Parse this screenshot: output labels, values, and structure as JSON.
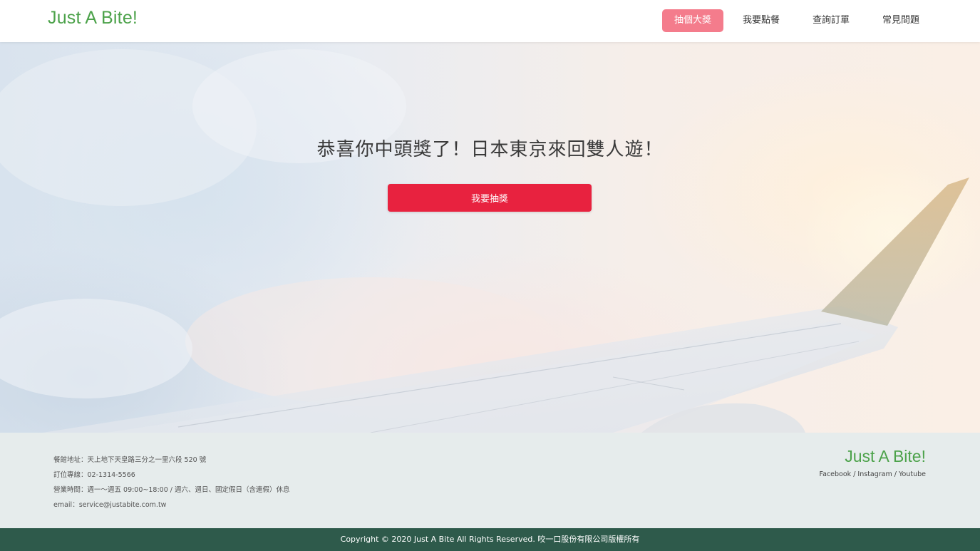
{
  "header": {
    "logo": "Just A Bite!",
    "nav": [
      {
        "label": "抽個大獎",
        "active": true
      },
      {
        "label": "我要點餐",
        "active": false
      },
      {
        "label": "查詢訂單",
        "active": false
      },
      {
        "label": "常見問題",
        "active": false
      }
    ]
  },
  "hero": {
    "title": "恭喜你中頭獎了！日本東京來回雙人遊！",
    "button_label": "我要抽獎"
  },
  "footer": {
    "address": "餐館地址：天上地下天皇路三分之一里六段 520 號",
    "phone": "訂位專線：02-1314-5566",
    "hours": "營業時間：週一～週五 09:00~18:00 / 週六、週日、國定假日（含連假）休息",
    "email": "email：service@justabite.com.tw",
    "logo": "Just A Bite!",
    "social": "Facebook / Instagram / Youtube",
    "copyright": "Copyright © 2020 Just A Bite All Rights Reserved. 咬一口股份有限公司版權所有"
  },
  "colors": {
    "brand_green": "#4ca24a",
    "nav_active": "#f47c8c",
    "cta_red": "#e8223f",
    "footer_bg": "#e6ecec",
    "copyright_bg": "#2e5a4b"
  }
}
